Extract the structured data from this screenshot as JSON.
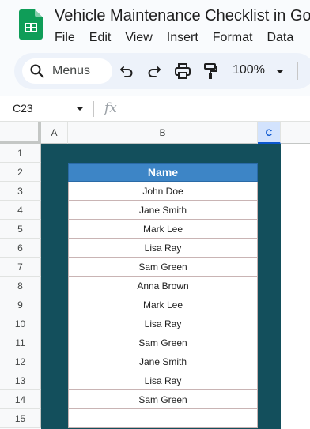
{
  "app": {
    "doc_title": "Vehicle Maintenance Checklist in Go",
    "menus": [
      "File",
      "Edit",
      "View",
      "Insert",
      "Format",
      "Data"
    ],
    "brand_color": "#0f9d58"
  },
  "toolbar": {
    "search_label": "Menus",
    "zoom": "100%",
    "icons": [
      "search-icon",
      "undo-icon",
      "redo-icon",
      "print-icon",
      "paint-format-icon",
      "chevron-down-icon"
    ]
  },
  "formula_bar": {
    "name_box": "C23",
    "fx_label": "fx"
  },
  "grid": {
    "columns": [
      "A",
      "B",
      "C"
    ],
    "selected_column": "C",
    "rows": [
      "1",
      "2",
      "3",
      "4",
      "5",
      "6",
      "7",
      "8",
      "9",
      "10",
      "11",
      "12",
      "13",
      "14",
      "15"
    ],
    "table_header": "Name",
    "names": [
      "John Doe",
      "Jane Smith",
      "Mark Lee",
      "Lisa Ray",
      "Sam Green",
      "Anna Brown",
      "Mark Lee",
      "Lisa Ray",
      "Sam Green",
      "Jane Smith",
      "Lisa Ray",
      "Sam Green",
      ""
    ],
    "colors": {
      "background_fill": "#134f5c",
      "header_fill": "#3d85c6"
    }
  }
}
